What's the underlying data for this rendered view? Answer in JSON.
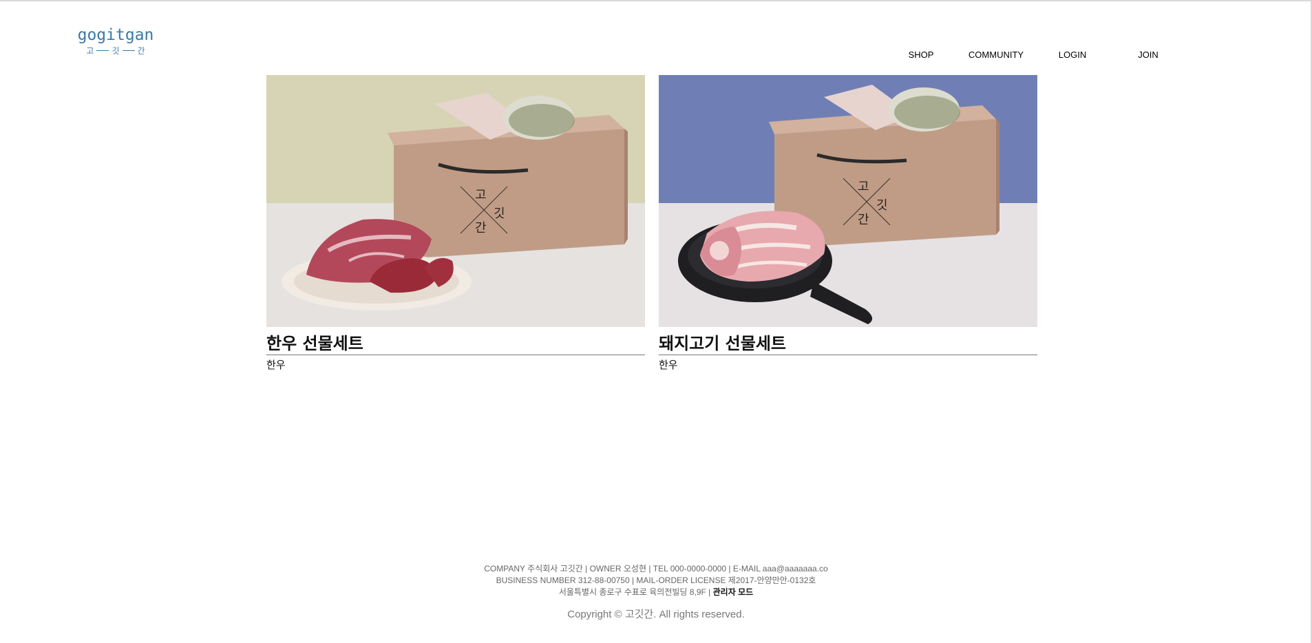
{
  "header": {
    "logo_text": "gogitgan",
    "logo_sub": [
      "고",
      "깃",
      "간"
    ],
    "nav": [
      "SHOP",
      "COMMUNITY",
      "LOGIN",
      "JOIN"
    ]
  },
  "products": [
    {
      "title": "한우 선물세트",
      "category": "한우",
      "box_text": [
        "고",
        "깃",
        "간"
      ],
      "backdrop": "#d6d4b4"
    },
    {
      "title": "돼지고기 선물세트",
      "category": "한우",
      "box_text": [
        "고",
        "깃",
        "간"
      ],
      "backdrop": "#6f7fb6"
    }
  ],
  "footer": {
    "line1": "COMPANY 주식회사 고깃간 | OWNER 오성현 | TEL 000-0000-0000 | E-MAIL aaa@aaaaaaa.co",
    "line2": "BUSINESS NUMBER 312-88-00750 | MAIL-ORDER LICENSE 제2017-안양만안-0132호",
    "line3": "서울특별시 종로구 수표로 육의전빌딩 8,9F |",
    "admin_link": "관리자 모드",
    "copyright": "Copyright © 고깃간. All rights reserved."
  }
}
